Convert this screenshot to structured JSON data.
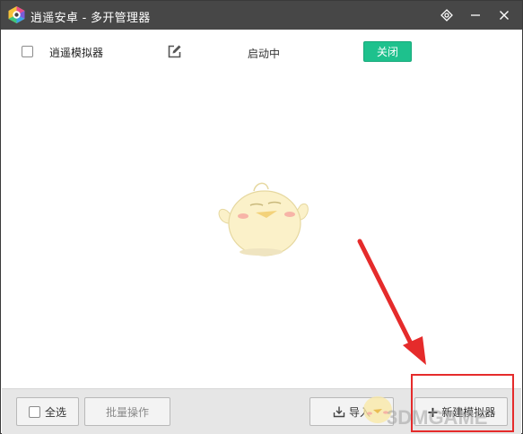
{
  "window": {
    "title": "逍遥安卓 - 多开管理器"
  },
  "instances": [
    {
      "name": "逍遥模拟器",
      "status": "启动中",
      "action_label": "关闭"
    }
  ],
  "footer": {
    "select_all_label": "全选",
    "batch_label": "批量操作",
    "import_label": "导入",
    "new_label": "新建模拟器"
  },
  "watermark": {
    "text": "3DMGAME"
  },
  "colors": {
    "titlebar": "#474747",
    "close_button": "#1ec18d",
    "highlight": "#e52b2b"
  },
  "icons": {
    "logo": "xiaoyao-logo-icon",
    "settings": "settings-icon",
    "minimize": "minimize-icon",
    "close": "close-icon",
    "edit": "edit-icon",
    "import": "import-icon",
    "plus": "plus-icon"
  }
}
